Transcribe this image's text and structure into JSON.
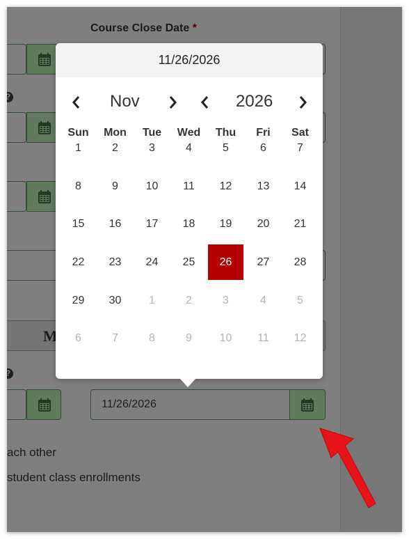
{
  "form": {
    "close_date_label": "Course Close Date",
    "required_mark": "*",
    "help_icon": "?",
    "big_button_partial": "M",
    "date_value": "11/26/2026",
    "text_line_1": "ach other",
    "text_line_2": "student class enrollments"
  },
  "datepicker": {
    "selected_date": "11/26/2026",
    "month": "Nov",
    "year": "2026",
    "weekdays": [
      "Sun",
      "Mon",
      "Tue",
      "Wed",
      "Thu",
      "Fri",
      "Sat"
    ],
    "weeks": [
      [
        "1",
        "2",
        "3",
        "4",
        "5",
        "6",
        "7"
      ],
      [
        "8",
        "9",
        "10",
        "11",
        "12",
        "13",
        "14"
      ],
      [
        "15",
        "16",
        "17",
        "18",
        "19",
        "20",
        "21"
      ],
      [
        "22",
        "23",
        "24",
        "25",
        "26",
        "27",
        "28"
      ],
      [
        "29",
        "30",
        "1",
        "2",
        "3",
        "4",
        "5"
      ],
      [
        "6",
        "7",
        "8",
        "9",
        "10",
        "11",
        "12"
      ]
    ],
    "selected_day": "26"
  },
  "colors": {
    "selected": "#b30000",
    "overlay": "#7f7f7f",
    "calendar_button": "#617a5e",
    "annotation_arrow": "#e8141b"
  },
  "icons": {
    "calendar": "calendar-icon",
    "help": "question-circle-icon",
    "prev": "chevron-left-icon",
    "next": "chevron-right-icon",
    "annotation": "red-arrow-icon"
  }
}
